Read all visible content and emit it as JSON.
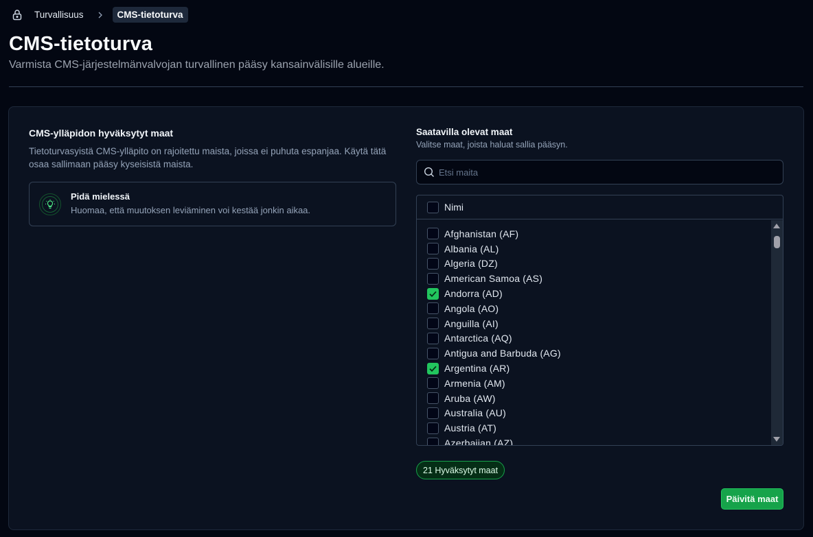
{
  "breadcrumb": {
    "items": [
      "Turvallisuus",
      "CMS-tietoturva"
    ]
  },
  "header": {
    "title": "CMS-tietoturva",
    "subtitle": "Varmista CMS-järjestelmänvalvojan turvallinen pääsy kansainvälisille alueille."
  },
  "left": {
    "title": "CMS-ylläpidon hyväksytyt maat",
    "description": "Tietoturvasyistä CMS-ylläpito on rajoitettu maista, joissa ei puhuta espanjaa. Käytä tätä osaa sallimaan pääsy kyseisistä maista.",
    "note": {
      "title": "Pidä mielessä",
      "text": "Huomaa, että muutoksen leviäminen voi kestää jonkin aikaa."
    }
  },
  "right": {
    "title": "Saatavilla olevat maat",
    "description": "Valitse maat, joista haluat sallia pääsyn.",
    "search_placeholder": "Etsi maita",
    "table_header": "Nimi",
    "countries": [
      {
        "label": "Afghanistan (AF)",
        "checked": false
      },
      {
        "label": "Albania (AL)",
        "checked": false
      },
      {
        "label": "Algeria (DZ)",
        "checked": false
      },
      {
        "label": "American Samoa (AS)",
        "checked": false
      },
      {
        "label": "Andorra (AD)",
        "checked": true
      },
      {
        "label": "Angola (AO)",
        "checked": false
      },
      {
        "label": "Anguilla (AI)",
        "checked": false
      },
      {
        "label": "Antarctica (AQ)",
        "checked": false
      },
      {
        "label": "Antigua and Barbuda (AG)",
        "checked": false
      },
      {
        "label": "Argentina (AR)",
        "checked": true
      },
      {
        "label": "Armenia (AM)",
        "checked": false
      },
      {
        "label": "Aruba (AW)",
        "checked": false
      },
      {
        "label": "Australia (AU)",
        "checked": false
      },
      {
        "label": "Austria (AT)",
        "checked": false
      },
      {
        "label": "Azerbaijan (AZ)",
        "checked": false
      }
    ],
    "badge": "21 Hyväksytyt maat",
    "update_button": "Päivitä maat"
  },
  "colors": {
    "accent": "#16a34a",
    "check": "#22c55e",
    "background": "#030712",
    "card": "#0b1220"
  },
  "icons": [
    "lock-icon",
    "chevron-right-icon",
    "lightbulb-icon",
    "search-icon",
    "check-icon"
  ]
}
